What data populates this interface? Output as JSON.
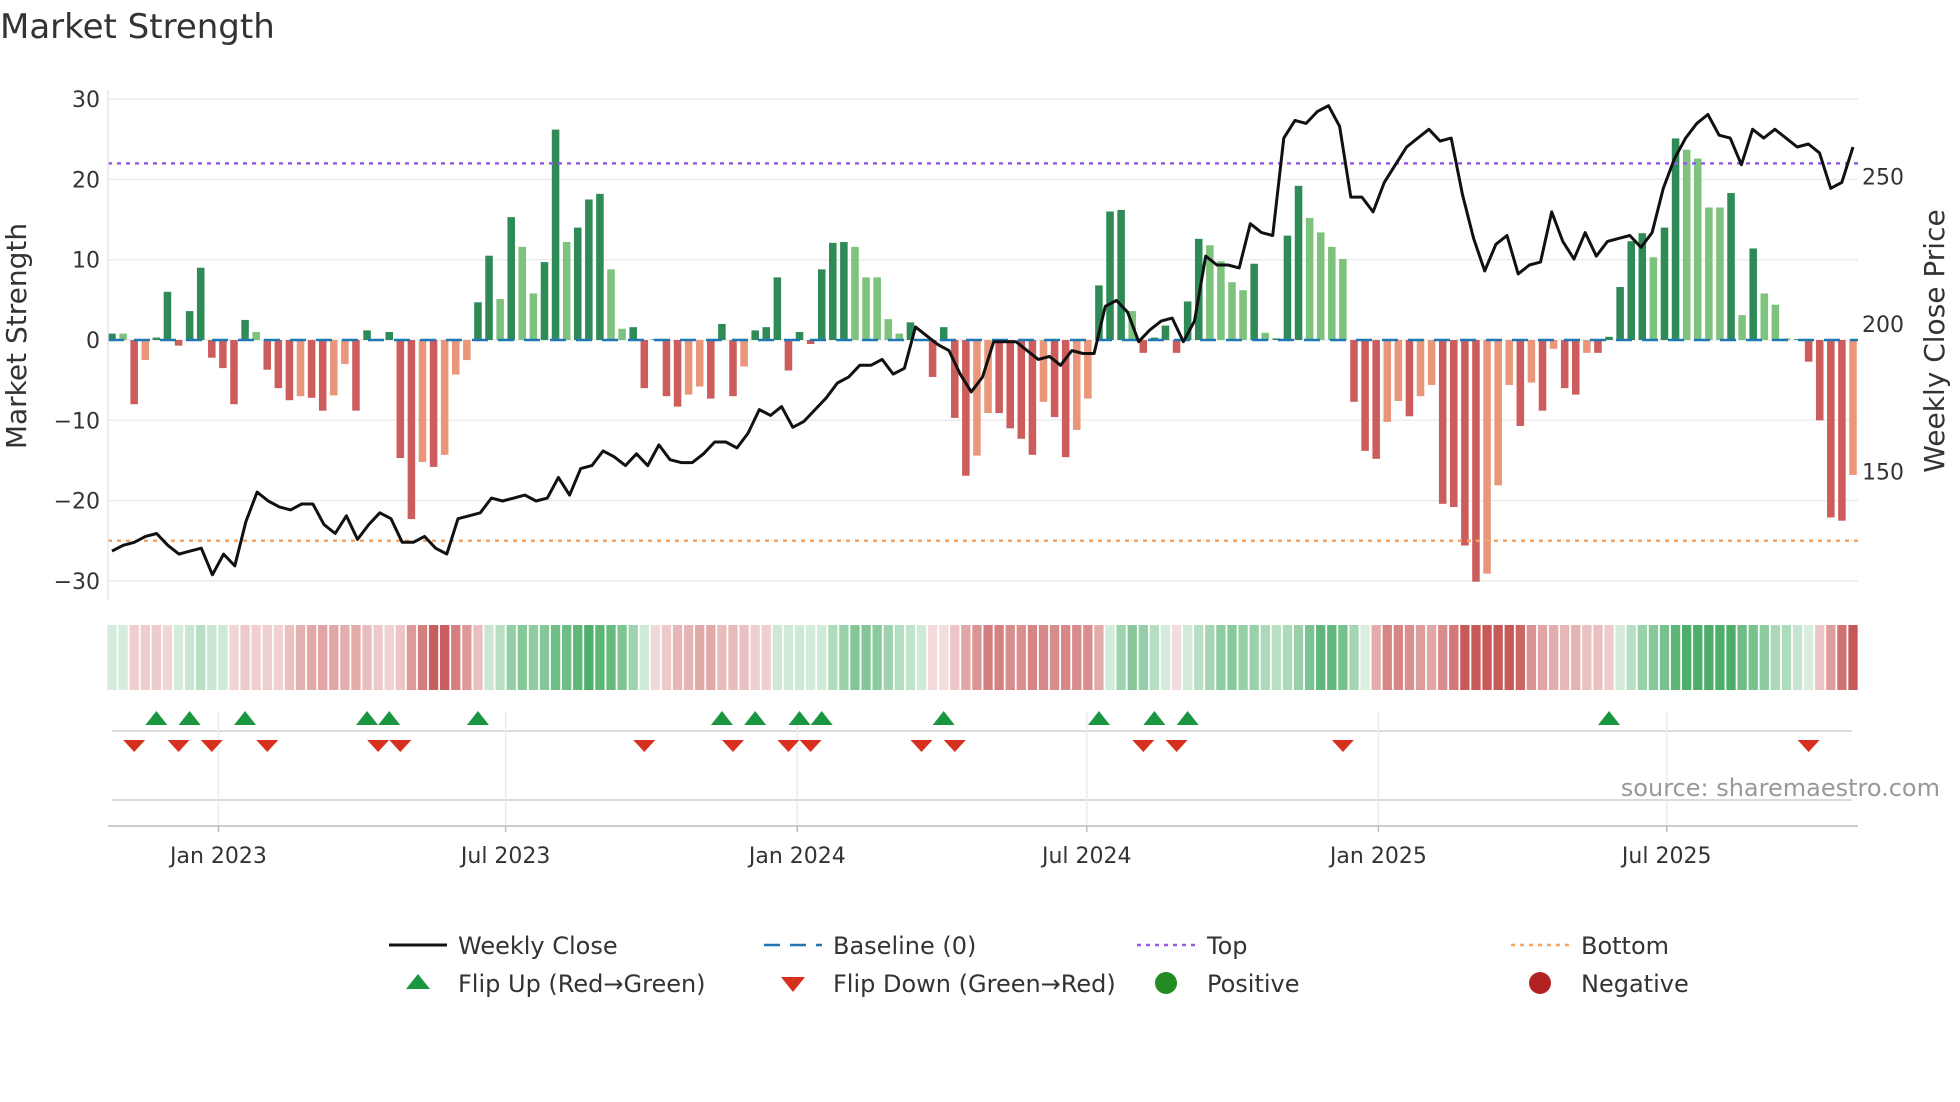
{
  "title": "Market Strength",
  "source": "source: sharemaestro.com",
  "colors": {
    "strong_green": "#2e8b57",
    "light_green": "#7dc27d",
    "strong_red": "#cd5c5c",
    "light_red": "#e9967a",
    "baseline": "#1f77b4",
    "top": "#9b59e6",
    "bottom": "#f4a460",
    "price": "#111111",
    "flip_up": "#1a9641",
    "flip_down": "#d7301f",
    "positive": "#228b22",
    "negative": "#b22222"
  },
  "chart_data": {
    "type": "bar",
    "title": "Market Strength",
    "ylabel": "Market Strength",
    "y2label": "Weekly Close Price",
    "ylim": [
      -32,
      32
    ],
    "y2lim": [
      110,
      280
    ],
    "yticks": [
      30,
      20,
      10,
      0,
      -10,
      -20,
      -30
    ],
    "ytick_labels": [
      "30",
      "20",
      "10",
      "0",
      "−10",
      "−20",
      "−30"
    ],
    "y2ticks": [
      250,
      200,
      150
    ],
    "y2tick_labels": [
      "250",
      "200",
      "150"
    ],
    "xtick_labels": [
      "Jan 2023",
      "Jul 2023",
      "Jan 2024",
      "Jul 2024",
      "Jan 2025",
      "Jul 2025"
    ],
    "xtick_week_index": [
      9.6,
      35.5,
      61.8,
      87.9,
      114.2,
      140.2
    ],
    "top_level": 22,
    "bottom_level": -25,
    "baseline": 0,
    "strength": [
      0.8,
      0.8,
      -8,
      -2.5,
      0.3,
      6,
      -0.7,
      3.6,
      9,
      -2.2,
      -3.5,
      -8,
      2.5,
      1,
      -3.7,
      -6,
      -7.5,
      -7,
      -7.2,
      -8.8,
      -6.9,
      -3,
      -8.8,
      1.2,
      0.1,
      1,
      -14.7,
      -22.3,
      -15.2,
      -15.8,
      -14.3,
      -4.3,
      -2.5,
      4.7,
      10.5,
      5.1,
      15.3,
      11.6,
      5.8,
      9.7,
      26.2,
      12.2,
      14,
      17.5,
      18.2,
      8.8,
      1.4,
      1.6,
      -6,
      0.1,
      -7,
      -8.3,
      -6.8,
      -5.8,
      -7.3,
      2,
      -7,
      -3.3,
      1.2,
      1.6,
      7.8,
      -3.8,
      1,
      -0.5,
      8.8,
      12.1,
      12.2,
      11.6,
      7.8,
      7.8,
      2.6,
      0.8,
      2.2,
      0.1,
      -4.6,
      1.6,
      -9.7,
      -16.9,
      -14.4,
      -9.1,
      -9.1,
      -11,
      -12.3,
      -14.3,
      -7.7,
      -9.6,
      -14.6,
      -11.2,
      -7.3,
      6.8,
      16,
      16.2,
      3.6,
      -1.6,
      0.3,
      1.8,
      -1.6,
      4.8,
      12.6,
      11.8,
      9.8,
      7.2,
      6.2,
      9.5,
      0.9,
      0.2,
      13,
      19.2,
      15.2,
      13.4,
      11.6,
      10.1,
      -7.7,
      -13.8,
      -14.8,
      -10.2,
      -7.6,
      -9.5,
      -7,
      -5.6,
      -20.4,
      -20.8,
      -25.6,
      -30.1,
      -29.1,
      -18.1,
      -5.6,
      -10.7,
      -5.3,
      -8.8,
      -1.1,
      -6,
      -6.8,
      -1.6,
      -1.6,
      0.4,
      6.6,
      12.3,
      13.3,
      10.3,
      14,
      25.1,
      23.7,
      22.6,
      16.5,
      16.5,
      18.3,
      3.1,
      11.4,
      5.8,
      4.4,
      0.2,
      0.1,
      -2.7,
      -10,
      -22.1,
      -22.5,
      -16.8
    ],
    "shade": [
      "G",
      "L",
      "R",
      "S",
      "G",
      "G",
      "R",
      "G",
      "G",
      "R",
      "R",
      "R",
      "G",
      "L",
      "R",
      "R",
      "R",
      "S",
      "R",
      "R",
      "S",
      "S",
      "R",
      "G",
      "G",
      "G",
      "R",
      "R",
      "S",
      "R",
      "S",
      "S",
      "S",
      "G",
      "G",
      "L",
      "G",
      "L",
      "L",
      "G",
      "G",
      "L",
      "G",
      "G",
      "G",
      "L",
      "L",
      "G",
      "R",
      "G",
      "R",
      "R",
      "S",
      "S",
      "R",
      "G",
      "R",
      "S",
      "G",
      "G",
      "G",
      "R",
      "G",
      "R",
      "G",
      "G",
      "G",
      "L",
      "L",
      "L",
      "L",
      "L",
      "G",
      "G",
      "R",
      "G",
      "R",
      "R",
      "S",
      "S",
      "R",
      "R",
      "R",
      "R",
      "S",
      "R",
      "R",
      "S",
      "S",
      "G",
      "G",
      "G",
      "L",
      "R",
      "G",
      "G",
      "R",
      "G",
      "G",
      "L",
      "L",
      "L",
      "L",
      "G",
      "L",
      "G",
      "G",
      "G",
      "L",
      "L",
      "L",
      "L",
      "R",
      "R",
      "R",
      "S",
      "S",
      "R",
      "S",
      "S",
      "R",
      "R",
      "R",
      "R",
      "S",
      "S",
      "S",
      "R",
      "S",
      "R",
      "S",
      "R",
      "R",
      "S",
      "R",
      "G",
      "G",
      "G",
      "G",
      "L",
      "G",
      "G",
      "L",
      "L",
      "L",
      "L",
      "G",
      "L",
      "G",
      "L",
      "L",
      "L",
      "G",
      "R",
      "R",
      "R",
      "R",
      "S"
    ],
    "weekly_close": [
      123,
      125,
      126,
      128,
      129,
      125,
      122,
      123,
      124,
      115,
      122,
      118,
      133,
      143,
      140,
      138,
      137,
      139,
      139,
      132,
      129,
      135,
      127,
      132,
      136,
      134,
      126,
      126,
      128,
      124,
      122,
      134,
      135,
      136,
      141,
      140,
      141,
      142,
      140,
      141,
      148,
      142,
      151,
      152,
      157,
      155,
      152,
      156,
      152,
      159,
      154,
      153,
      153,
      156,
      160,
      160,
      158,
      163,
      171,
      169,
      172,
      165,
      167,
      171,
      175,
      180,
      182,
      186,
      186,
      188,
      183,
      185,
      199,
      196,
      193,
      191,
      183,
      177,
      182,
      194,
      194,
      194,
      191,
      188,
      189,
      186,
      191,
      190,
      190,
      206,
      208,
      204,
      194,
      198,
      201,
      202,
      194,
      201,
      223,
      220,
      220,
      219,
      234,
      231,
      230,
      263,
      269,
      268,
      272,
      274,
      267,
      243,
      243,
      238,
      248,
      254,
      260,
      263,
      266,
      262,
      263,
      244,
      229,
      218,
      227,
      230,
      217,
      220,
      221,
      238,
      228,
      222,
      231,
      223,
      228,
      229,
      230,
      226,
      231,
      246,
      256,
      263,
      268,
      271,
      264,
      263,
      254,
      266,
      263,
      266,
      263,
      260,
      261,
      258,
      246,
      248,
      260
    ],
    "flip_up_week_index": [
      4,
      7,
      12,
      23,
      25,
      33,
      55,
      58,
      62,
      64,
      75,
      89,
      94,
      97,
      135
    ],
    "flip_down_week_index": [
      2,
      6,
      9,
      14,
      24,
      26,
      48,
      56,
      61,
      63,
      73,
      76,
      93,
      96,
      111,
      153
    ],
    "legend": [
      {
        "label": "Weekly Close",
        "kind": "line"
      },
      {
        "label": "Baseline (0)",
        "kind": "dash"
      },
      {
        "label": "Top",
        "kind": "dot-top"
      },
      {
        "label": "Bottom",
        "kind": "dot-bottom"
      },
      {
        "label": "Flip Up (Red→Green)",
        "kind": "tri-up"
      },
      {
        "label": "Flip Down (Green→Red)",
        "kind": "tri-down"
      },
      {
        "label": "Positive",
        "kind": "dot-pos"
      },
      {
        "label": "Negative",
        "kind": "dot-neg"
      }
    ],
    "legend_position": "bottom"
  }
}
